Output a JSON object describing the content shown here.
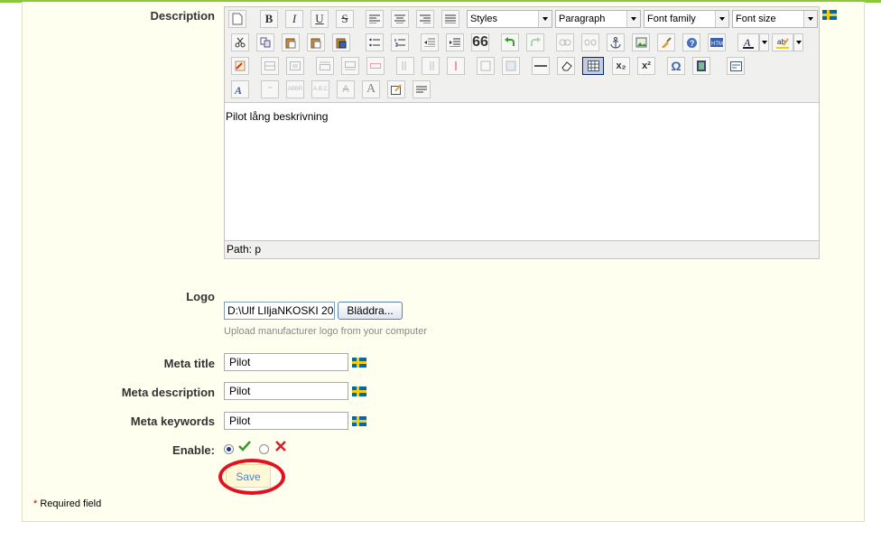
{
  "labels": {
    "description": "Description",
    "logo": "Logo",
    "meta_title": "Meta title",
    "meta_description": "Meta description",
    "meta_keywords": "Meta keywords",
    "enable": "Enable:"
  },
  "editor": {
    "selects": {
      "styles": "Styles",
      "paragraph": "Paragraph",
      "font_family": "Font family",
      "font_size": "Font size"
    },
    "content": "Pilot lång beskrivning",
    "path": "Path: p",
    "button_glyphs": {
      "bold": "B",
      "italic": "I",
      "underline": "U",
      "strike": "S",
      "quote": "66",
      "sub": "x₂",
      "sup": "x²",
      "omega": "Ω"
    }
  },
  "logo": {
    "file_value": "D:\\Ulf LIljaNKOSKI 20",
    "browse_label": "Bläddra...",
    "hint": "Upload manufacturer logo from your computer"
  },
  "fields": {
    "meta_title": "Pilot",
    "meta_description": "Pilot",
    "meta_keywords": "Pilot"
  },
  "save_label": "Save",
  "required_note": "Required field",
  "required_star": "*",
  "colors": {
    "accent": "#8dc63f",
    "highlight_circle": "#e3101d",
    "panel_bg": "#fffff0"
  }
}
